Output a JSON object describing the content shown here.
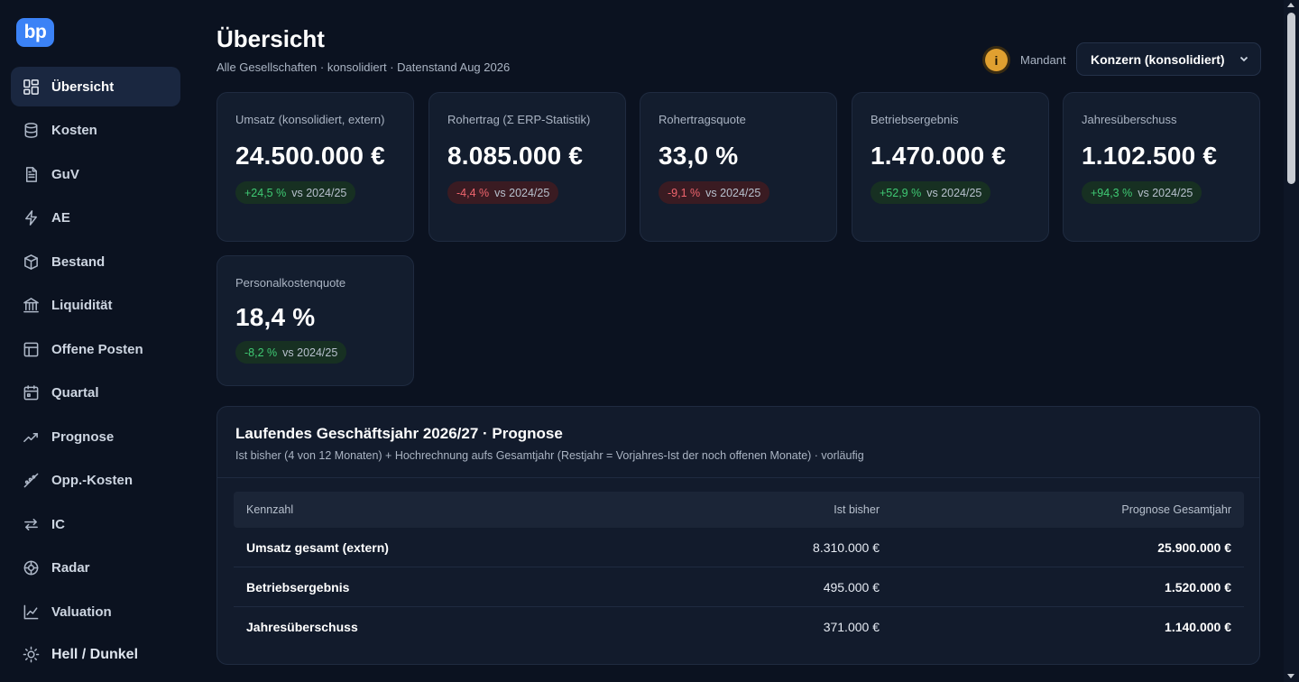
{
  "app": {
    "logo_text": "bp"
  },
  "sidebar": {
    "items": [
      {
        "label": "Übersicht",
        "icon": "dashboard-grid-icon",
        "active": true
      },
      {
        "label": "Kosten",
        "icon": "database-icon"
      },
      {
        "label": "GuV",
        "icon": "document-icon"
      },
      {
        "label": "AE",
        "icon": "lightning-icon"
      },
      {
        "label": "Bestand",
        "icon": "box-icon"
      },
      {
        "label": "Liquidität",
        "icon": "bank-icon"
      },
      {
        "label": "Offene Posten",
        "icon": "layout-table-icon"
      },
      {
        "label": "Quartal",
        "icon": "calendar-icon"
      },
      {
        "label": "Prognose",
        "icon": "trend-up-icon"
      },
      {
        "label": "Opp.-Kosten",
        "icon": "scatter-line-icon"
      },
      {
        "label": "IC",
        "icon": "arrows-exchange-icon"
      },
      {
        "label": "Radar",
        "icon": "radar-icon"
      },
      {
        "label": "Valuation",
        "icon": "line-chart-icon"
      }
    ],
    "theme_toggle": {
      "label": "Hell / Dunkel",
      "icon": "sun-icon"
    }
  },
  "header": {
    "title": "Übersicht",
    "subtitle": "Alle Gesellschaften · konsolidiert · Datenstand Aug 2026",
    "info_badge": "i",
    "mandant_label": "Mandant",
    "mandant_value": "Konzern (konsolidiert)"
  },
  "kpis": [
    {
      "label": "Umsatz (konsolidiert, extern)",
      "value": "24.500.000 €",
      "delta": "+24,5 %",
      "vs": "vs 2024/25",
      "trend": "pos"
    },
    {
      "label": "Rohertrag (Σ ERP-Statistik)",
      "value": "8.085.000 €",
      "delta": "-4,4 %",
      "vs": "vs 2024/25",
      "trend": "neg"
    },
    {
      "label": "Rohertragsquote",
      "value": "33,0 %",
      "delta": "-9,1 %",
      "vs": "vs 2024/25",
      "trend": "neg"
    },
    {
      "label": "Betriebsergebnis",
      "value": "1.470.000 €",
      "delta": "+52,9 %",
      "vs": "vs 2024/25",
      "trend": "pos"
    },
    {
      "label": "Jahresüberschuss",
      "value": "1.102.500 €",
      "delta": "+94,3 %",
      "vs": "vs 2024/25",
      "trend": "pos"
    },
    {
      "label": "Personalkostenquote",
      "value": "18,4 %",
      "delta": "-8,2 %",
      "vs": "vs 2024/25",
      "trend": "pos"
    }
  ],
  "forecast": {
    "title": "Laufendes Geschäftsjahr 2026/27 · Prognose",
    "subtitle": "Ist bisher (4 von 12 Monaten) + Hochrechnung aufs Gesamtjahr (Restjahr = Vorjahres-Ist der noch offenen Monate) · vorläufig",
    "columns": [
      "Kennzahl",
      "Ist bisher",
      "Prognose Gesamtjahr"
    ],
    "rows": [
      [
        "Umsatz gesamt (extern)",
        "8.310.000 €",
        "25.900.000 €"
      ],
      [
        "Betriebsergebnis",
        "495.000 €",
        "1.520.000 €"
      ],
      [
        "Jahresüberschuss",
        "371.000 €",
        "1.140.000 €"
      ]
    ]
  },
  "colors": {
    "background": "#0b1220",
    "card": "#131d2e",
    "accent": "#3b82f6",
    "positive": "#3fca74",
    "negative": "#f0656e",
    "warning": "#e0a030"
  }
}
